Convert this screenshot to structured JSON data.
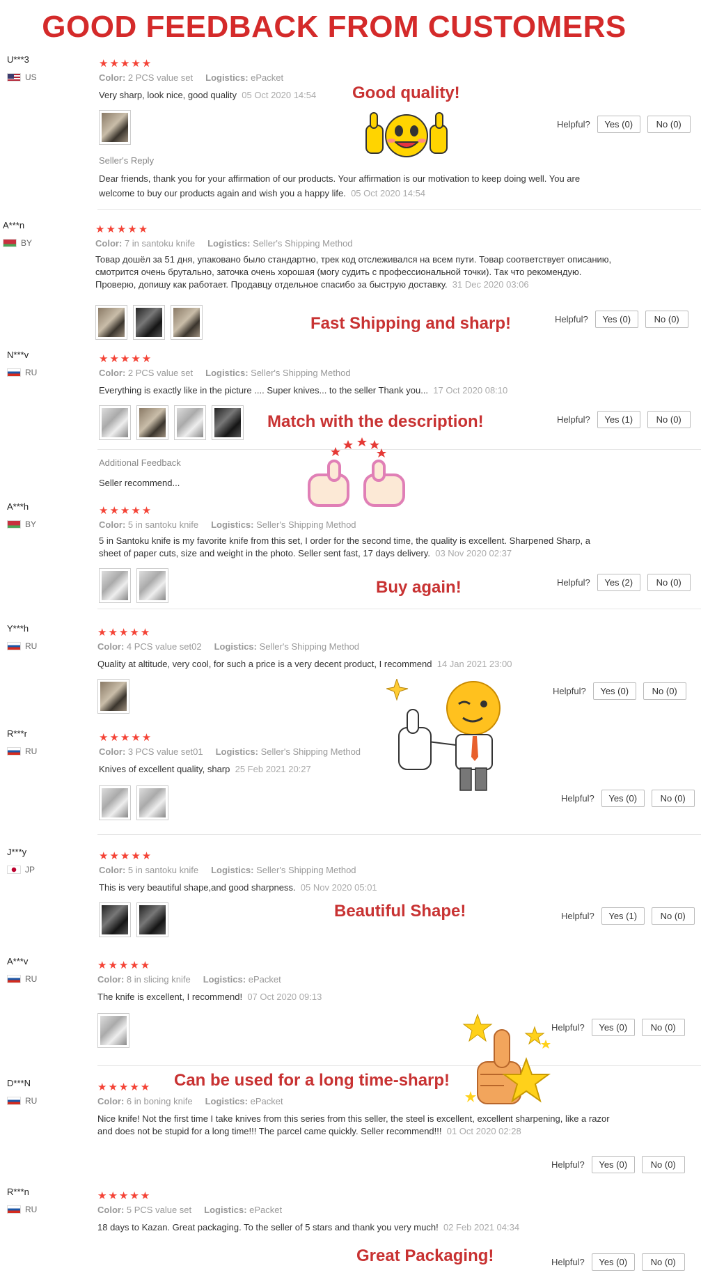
{
  "headline": "GOOD FEEDBACK FROM CUSTOMERS",
  "labels": {
    "helpful": "Helpful?",
    "color": "Color:",
    "logistics": "Logistics:",
    "sellers_reply": "Seller's Reply",
    "additional_feedback": "Additional Feedback",
    "stars": "★★★★★"
  },
  "promos": {
    "good_quality": "Good quality!",
    "fast_shipping": "Fast Shipping and sharp!",
    "match_description": "Match with the description!",
    "buy_again": "Buy again!",
    "beautiful_shape": "Beautiful Shape!",
    "long_time_sharp": "Can be used for a long time-sharp!",
    "great_packaging": "Great Packaging!"
  },
  "reviews": [
    {
      "user": "U***3",
      "country": "US",
      "rating": 5,
      "color": "2 PCS value set",
      "logistics": "ePacket",
      "text": "Very sharp, look nice, good quality",
      "date": "05 Oct 2020 14:54",
      "yes": "Yes (0)",
      "no": "No (0)",
      "reply": "Dear friends, thank you for your affirmation of our products. Your affirmation is our motivation to keep doing well. You are welcome to buy our products again and wish you a happy life.",
      "reply_date": "05 Oct 2020 14:54"
    },
    {
      "user": "A***n",
      "country": "BY",
      "rating": 5,
      "color": "7 in santoku knife",
      "logistics": "Seller's Shipping Method",
      "text": "Товар дошёл за 51 дня, упаковано было стандартно, трек код отслеживался на всем пути. Товар соответствует описанию, смотрится очень брутально, заточка очень хорошая (могу судить с профессиональной точки). Так что рекомендую. Проверю, допишу как работает. Продавцу отдельное спасибо за быструю доставку.",
      "date": "31 Dec 2020 03:06",
      "yes": "Yes (0)",
      "no": "No (0)"
    },
    {
      "user": "N***v",
      "country": "RU",
      "rating": 5,
      "color": "2 PCS value set",
      "logistics": "Seller's Shipping Method",
      "text": "Everything is exactly like in the picture .... Super knives... to the seller Thank you...",
      "date": "17 Oct 2020 08:10",
      "yes": "Yes (1)",
      "no": "No (0)",
      "additional": "Seller recommend..."
    },
    {
      "user": "A***h",
      "country": "BY",
      "rating": 5,
      "color": "5 in santoku knife",
      "logistics": "Seller's Shipping Method",
      "text": "5 in Santoku knife is my favorite knife from this set, I order for the second time, the quality is excellent. Sharpened Sharp, a sheet of paper cuts, size and weight in the photo. Seller sent fast, 17 days delivery.",
      "date": "03 Nov 2020 02:37",
      "yes": "Yes (2)",
      "no": "No (0)"
    },
    {
      "user": "Y***h",
      "country": "RU",
      "rating": 5,
      "color": "4 PCS value set02",
      "logistics": "Seller's Shipping Method",
      "text": "Quality at altitude, very cool, for such a price is a very decent product, I recommend",
      "date": "14 Jan 2021 23:00",
      "yes": "Yes (0)",
      "no": "No (0)"
    },
    {
      "user": "R***r",
      "country": "RU",
      "rating": 5,
      "color": "3 PCS value set01",
      "logistics": "Seller's Shipping Method",
      "text": "Knives of excellent quality, sharp",
      "date": "25 Feb 2021 20:27",
      "yes": "Yes (0)",
      "no": "No (0)"
    },
    {
      "user": "J***y",
      "country": "JP",
      "rating": 5,
      "color": "5 in santoku knife",
      "logistics": "Seller's Shipping Method",
      "text": "This is very beautiful shape,and good sharpness.",
      "date": "05 Nov 2020 05:01",
      "yes": "Yes (1)",
      "no": "No (0)"
    },
    {
      "user": "A***v",
      "country": "RU",
      "rating": 5,
      "color": "8 in slicing knife",
      "logistics": "ePacket",
      "text": "The knife is excellent, I recommend!",
      "date": "07 Oct 2020 09:13",
      "yes": "Yes (0)",
      "no": "No (0)"
    },
    {
      "user": "D***N",
      "country": "RU",
      "rating": 5,
      "color": "6 in boning knife",
      "logistics": "ePacket",
      "text": "Nice knife! Not the first time I take knives from this series from this seller, the steel is excellent, excellent sharpening, like a razor and does not be stupid for a long time!!! The parcel came quickly. Seller recommend!!!",
      "date": "01 Oct 2020 02:28",
      "yes": "Yes (0)",
      "no": "No (0)"
    },
    {
      "user": "R***n",
      "country": "RU",
      "rating": 5,
      "color": "5 PCS value set",
      "logistics": "ePacket",
      "text": "18 days to Kazan. Great packaging. To the seller of 5 stars and thank you very much!",
      "date": "02 Feb 2021 04:34",
      "yes": "Yes (0)",
      "no": "No (0)"
    }
  ],
  "colors": {
    "headline": "#d42a2a",
    "stars": "#f44336",
    "promo": "#c83232"
  }
}
